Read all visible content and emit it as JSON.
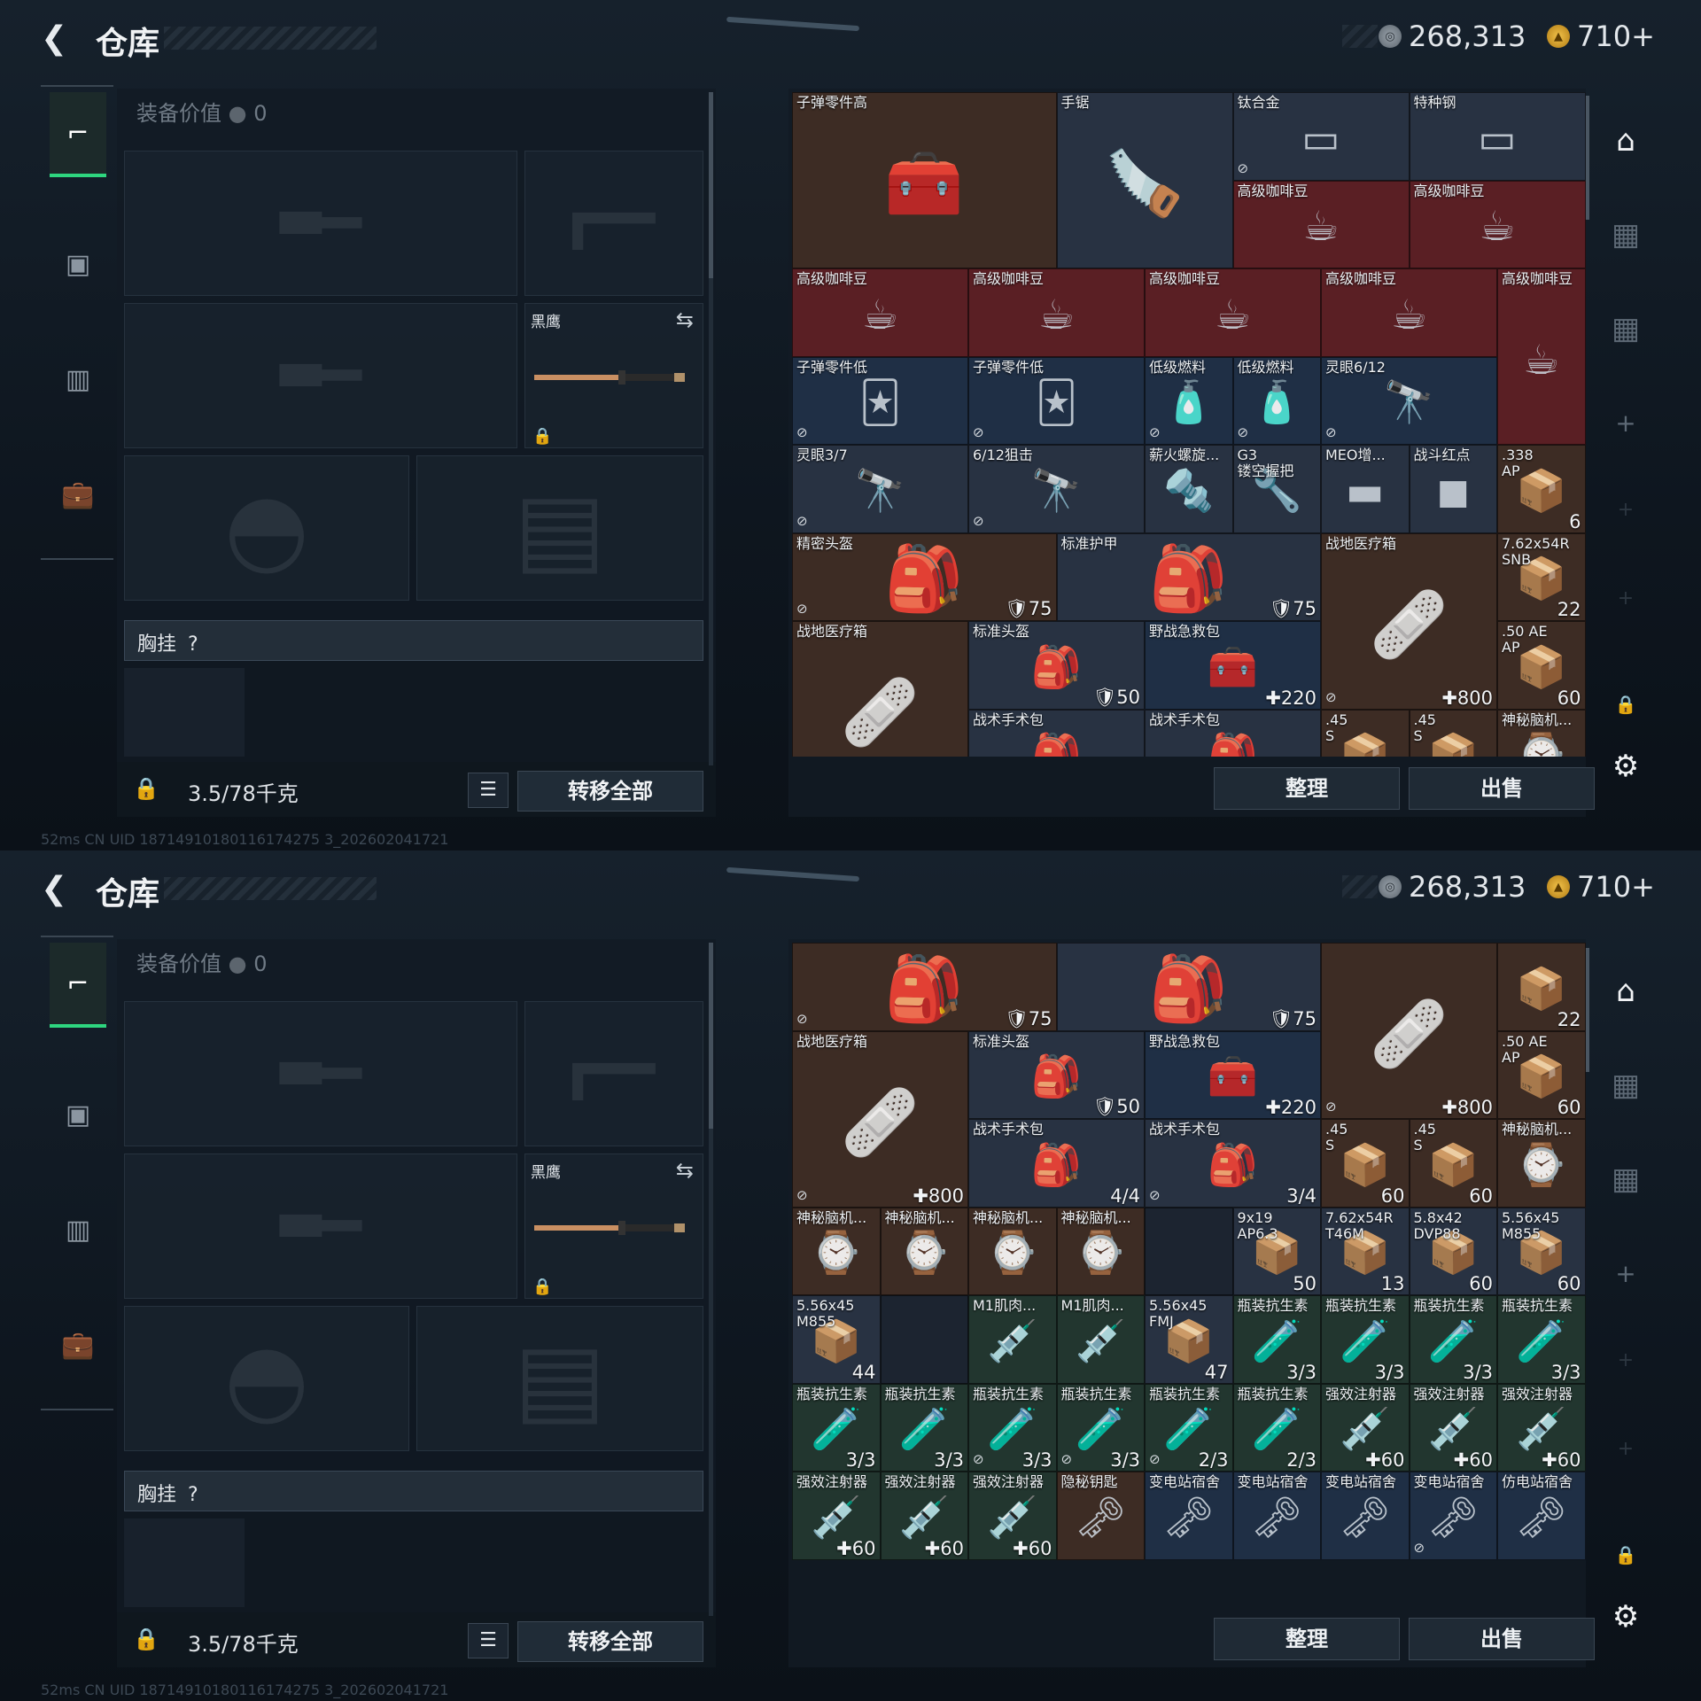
{
  "header": {
    "title": "仓库",
    "silver": "268,313",
    "gold": "710+"
  },
  "loadout": {
    "equip_value_label": "装备价值",
    "equip_value": "0",
    "melee_label": "黑鹰",
    "chest_label": "胸挂",
    "chest_help": "?",
    "weight": "3.5/78千克",
    "transfer_all": "转移全部"
  },
  "storage": {
    "sort": "整理",
    "sell": "出售"
  },
  "status_text": "52ms   CN UID 18714910180116174275 3_202602041721",
  "screen1_cells": [
    {
      "c": 0,
      "r": 0,
      "w": 3,
      "h": 2,
      "n": "子弹零件高",
      "bg": "c-brown",
      "i": "🧰"
    },
    {
      "c": 3,
      "r": 0,
      "w": 2,
      "h": 2,
      "n": "手锯",
      "bg": "c-slate",
      "i": "🪚"
    },
    {
      "c": 5,
      "r": 0,
      "w": 2,
      "h": 1,
      "n": "钛合金",
      "bg": "c-slate",
      "i": "▭",
      "nl": true
    },
    {
      "c": 7,
      "r": 0,
      "w": 2,
      "h": 1,
      "n": "特种钢",
      "bg": "c-slate",
      "i": "▭"
    },
    {
      "c": 5,
      "r": 1,
      "w": 2,
      "h": 1,
      "n": "高级咖啡豆",
      "bg": "c-red",
      "i": "☕"
    },
    {
      "c": 7,
      "r": 1,
      "w": 2,
      "h": 1,
      "n": "高级咖啡豆",
      "bg": "c-red",
      "i": "☕"
    },
    {
      "c": 0,
      "r": 2,
      "w": 2,
      "h": 1,
      "n": "高级咖啡豆",
      "bg": "c-red",
      "i": "☕"
    },
    {
      "c": 2,
      "r": 2,
      "w": 2,
      "h": 1,
      "n": "高级咖啡豆",
      "bg": "c-red",
      "i": "☕"
    },
    {
      "c": 4,
      "r": 2,
      "w": 2,
      "h": 1,
      "n": "高级咖啡豆",
      "bg": "c-red",
      "i": "☕"
    },
    {
      "c": 6,
      "r": 2,
      "w": 2,
      "h": 1,
      "n": "高级咖啡豆",
      "bg": "c-red",
      "i": "☕"
    },
    {
      "c": 8,
      "r": 2,
      "w": 1,
      "h": 2,
      "n": "高级咖啡豆",
      "bg": "c-red",
      "i": "☕"
    },
    {
      "c": 0,
      "r": 3,
      "w": 2,
      "h": 1,
      "n": "子弹零件低",
      "bg": "c-blue",
      "i": "🃏",
      "nl": true
    },
    {
      "c": 2,
      "r": 3,
      "w": 2,
      "h": 1,
      "n": "子弹零件低",
      "bg": "c-blue",
      "i": "🃏",
      "nl": true
    },
    {
      "c": 4,
      "r": 3,
      "w": 1,
      "h": 1,
      "n": "低级燃料",
      "bg": "c-blue",
      "i": "🧴",
      "nl": true
    },
    {
      "c": 5,
      "r": 3,
      "w": 1,
      "h": 1,
      "n": "低级燃料",
      "bg": "c-blue",
      "i": "🧴",
      "nl": true
    },
    {
      "c": 6,
      "r": 3,
      "w": 2,
      "h": 1,
      "n": "灵眼6/12",
      "bg": "c-blue",
      "i": "🔭",
      "nl": true
    },
    {
      "c": 0,
      "r": 4,
      "w": 2,
      "h": 1,
      "n": "灵眼3/7",
      "bg": "c-slate",
      "i": "🔭",
      "nl": true
    },
    {
      "c": 2,
      "r": 4,
      "w": 2,
      "h": 1,
      "n": "6/12狙击",
      "bg": "c-slate",
      "i": "🔭",
      "nl": true
    },
    {
      "c": 4,
      "r": 4,
      "w": 1,
      "h": 1,
      "n": "薪火螺旋...",
      "bg": "c-slate",
      "i": "🔩"
    },
    {
      "c": 5,
      "r": 4,
      "w": 1,
      "h": 1,
      "n": "G3\n镂空握把",
      "bg": "c-slate",
      "i": "🔧"
    },
    {
      "c": 6,
      "r": 4,
      "w": 1,
      "h": 1,
      "n": "MEO增...",
      "bg": "c-slate",
      "i": "▬"
    },
    {
      "c": 7,
      "r": 4,
      "w": 1,
      "h": 1,
      "n": "战斗红点",
      "bg": "c-slate",
      "i": "◼"
    },
    {
      "c": 8,
      "r": 4,
      "w": 1,
      "h": 1,
      "n": ".338\nAP",
      "bg": "c-brown",
      "i": "📦",
      "ct": "6"
    },
    {
      "c": 0,
      "r": 5,
      "w": 3,
      "h": 1,
      "n": "精密头盔",
      "bg": "c-brown",
      "i": "🎒",
      "ct": "🛡75",
      "nl": true
    },
    {
      "c": 3,
      "r": 5,
      "w": 3,
      "h": 1,
      "n": "标准护甲",
      "bg": "c-slate",
      "i": "🎒",
      "ct": "🛡75"
    },
    {
      "c": 6,
      "r": 5,
      "w": 2,
      "h": 2,
      "n": "战地医疗箱",
      "bg": "c-brown",
      "i": "🩹",
      "ct": "✚800",
      "nl": true
    },
    {
      "c": 8,
      "r": 5,
      "w": 1,
      "h": 1,
      "n": "7.62x54R\nSNB",
      "bg": "c-brown",
      "i": "📦",
      "ct": "22"
    },
    {
      "c": 0,
      "r": 6,
      "w": 2,
      "h": 2,
      "n": "战地医疗箱",
      "bg": "c-brown",
      "i": "🩹"
    },
    {
      "c": 2,
      "r": 6,
      "w": 2,
      "h": 1,
      "n": "标准头盔",
      "bg": "c-slate",
      "i": "🎒",
      "ct": "🛡50"
    },
    {
      "c": 4,
      "r": 6,
      "w": 2,
      "h": 1,
      "n": "野战急救包",
      "bg": "c-blue",
      "i": "🧰",
      "ct": "✚220"
    },
    {
      "c": 8,
      "r": 6,
      "w": 1,
      "h": 1,
      "n": ".50 AE\nAP",
      "bg": "c-brown",
      "i": "📦",
      "ct": "60"
    },
    {
      "c": 2,
      "r": 7,
      "w": 2,
      "h": 1,
      "n": "战术手术包",
      "bg": "c-slate",
      "i": "🎒"
    },
    {
      "c": 4,
      "r": 7,
      "w": 2,
      "h": 1,
      "n": "战术手术包",
      "bg": "c-slate",
      "i": "🎒"
    },
    {
      "c": 6,
      "r": 7,
      "w": 1,
      "h": 1,
      "n": ".45\nS",
      "bg": "c-brown",
      "i": "📦"
    },
    {
      "c": 7,
      "r": 7,
      "w": 1,
      "h": 1,
      "n": ".45\nS",
      "bg": "c-brown",
      "i": "📦"
    },
    {
      "c": 8,
      "r": 7,
      "w": 1,
      "h": 1,
      "n": "神秘脑机...",
      "bg": "c-brown",
      "i": "⌚"
    }
  ],
  "screen2_cells": [
    {
      "c": 0,
      "r": 0,
      "w": 3,
      "h": 1,
      "n": "",
      "bg": "c-brown",
      "i": "🎒",
      "ct": "🛡75",
      "nl": true
    },
    {
      "c": 3,
      "r": 0,
      "w": 3,
      "h": 1,
      "n": "",
      "bg": "c-slate",
      "i": "🎒",
      "ct": "🛡75"
    },
    {
      "c": 6,
      "r": 0,
      "w": 2,
      "h": 2,
      "n": "",
      "bg": "c-brown",
      "i": "🩹",
      "ct": "✚800",
      "nl": true
    },
    {
      "c": 8,
      "r": 0,
      "w": 1,
      "h": 1,
      "n": "",
      "bg": "c-brown",
      "i": "📦",
      "ct": "22"
    },
    {
      "c": 0,
      "r": 1,
      "w": 2,
      "h": 2,
      "n": "战地医疗箱",
      "bg": "c-brown",
      "i": "🩹",
      "ct": "✚800",
      "nl": true
    },
    {
      "c": 2,
      "r": 1,
      "w": 2,
      "h": 1,
      "n": "标准头盔",
      "bg": "c-slate",
      "i": "🎒",
      "ct": "🛡50"
    },
    {
      "c": 4,
      "r": 1,
      "w": 2,
      "h": 1,
      "n": "野战急救包",
      "bg": "c-blue",
      "i": "🧰",
      "ct": "✚220"
    },
    {
      "c": 8,
      "r": 1,
      "w": 1,
      "h": 1,
      "n": ".50 AE\nAP",
      "bg": "c-brown",
      "i": "📦",
      "ct": "60"
    },
    {
      "c": 2,
      "r": 2,
      "w": 2,
      "h": 1,
      "n": "战术手术包",
      "bg": "c-slate",
      "i": "🎒",
      "ct": "4/4"
    },
    {
      "c": 4,
      "r": 2,
      "w": 2,
      "h": 1,
      "n": "战术手术包",
      "bg": "c-slate",
      "i": "🎒",
      "ct": "3/4",
      "nl": true
    },
    {
      "c": 6,
      "r": 2,
      "w": 1,
      "h": 1,
      "n": ".45\nS",
      "bg": "c-brown",
      "i": "📦",
      "ct": "60"
    },
    {
      "c": 7,
      "r": 2,
      "w": 1,
      "h": 1,
      "n": ".45\nS",
      "bg": "c-brown",
      "i": "📦",
      "ct": "60"
    },
    {
      "c": 8,
      "r": 2,
      "w": 1,
      "h": 1,
      "n": "神秘脑机...",
      "bg": "c-brown",
      "i": "⌚"
    },
    {
      "c": 0,
      "r": 3,
      "w": 1,
      "h": 1,
      "n": "神秘脑机...",
      "bg": "c-brown",
      "i": "⌚"
    },
    {
      "c": 1,
      "r": 3,
      "w": 1,
      "h": 1,
      "n": "神秘脑机...",
      "bg": "c-brown",
      "i": "⌚"
    },
    {
      "c": 2,
      "r": 3,
      "w": 1,
      "h": 1,
      "n": "神秘脑机...",
      "bg": "c-brown",
      "i": "⌚"
    },
    {
      "c": 3,
      "r": 3,
      "w": 1,
      "h": 1,
      "n": "神秘脑机...",
      "bg": "c-brown",
      "i": "⌚"
    },
    {
      "c": 4,
      "r": 3,
      "w": 1,
      "h": 1,
      "n": "",
      "bg": "c-dark",
      "i": ""
    },
    {
      "c": 5,
      "r": 3,
      "w": 1,
      "h": 1,
      "n": "9x19\nAP6.3",
      "bg": "c-slate",
      "i": "📦",
      "ct": "50"
    },
    {
      "c": 6,
      "r": 3,
      "w": 1,
      "h": 1,
      "n": "7.62x54R\nT46M",
      "bg": "c-slate",
      "i": "📦",
      "ct": "13"
    },
    {
      "c": 7,
      "r": 3,
      "w": 1,
      "h": 1,
      "n": "5.8x42\nDVP88",
      "bg": "c-slate",
      "i": "📦",
      "ct": "60"
    },
    {
      "c": 8,
      "r": 3,
      "w": 1,
      "h": 1,
      "n": "5.56x45\nM855",
      "bg": "c-slate",
      "i": "📦",
      "ct": "60"
    },
    {
      "c": 0,
      "r": 4,
      "w": 1,
      "h": 1,
      "n": "5.56x45\nM855",
      "bg": "c-slate",
      "i": "📦",
      "ct": "44"
    },
    {
      "c": 1,
      "r": 4,
      "w": 1,
      "h": 1,
      "n": "",
      "bg": "c-dark",
      "i": ""
    },
    {
      "c": 2,
      "r": 4,
      "w": 1,
      "h": 1,
      "n": "M1肌肉...",
      "bg": "c-green",
      "i": "💉"
    },
    {
      "c": 3,
      "r": 4,
      "w": 1,
      "h": 1,
      "n": "M1肌肉...",
      "bg": "c-green",
      "i": "💉"
    },
    {
      "c": 4,
      "r": 4,
      "w": 1,
      "h": 1,
      "n": "5.56x45\nFMJ",
      "bg": "c-slate",
      "i": "📦",
      "ct": "47"
    },
    {
      "c": 5,
      "r": 4,
      "w": 1,
      "h": 1,
      "n": "瓶装抗生素",
      "bg": "c-green",
      "i": "🧪",
      "ct": "3/3"
    },
    {
      "c": 6,
      "r": 4,
      "w": 1,
      "h": 1,
      "n": "瓶装抗生素",
      "bg": "c-green",
      "i": "🧪",
      "ct": "3/3"
    },
    {
      "c": 7,
      "r": 4,
      "w": 1,
      "h": 1,
      "n": "瓶装抗生素",
      "bg": "c-green",
      "i": "🧪",
      "ct": "3/3"
    },
    {
      "c": 8,
      "r": 4,
      "w": 1,
      "h": 1,
      "n": "瓶装抗生素",
      "bg": "c-green",
      "i": "🧪",
      "ct": "3/3"
    },
    {
      "c": 0,
      "r": 5,
      "w": 1,
      "h": 1,
      "n": "瓶装抗生素",
      "bg": "c-green",
      "i": "🧪",
      "ct": "3/3"
    },
    {
      "c": 1,
      "r": 5,
      "w": 1,
      "h": 1,
      "n": "瓶装抗生素",
      "bg": "c-green",
      "i": "🧪",
      "ct": "3/3"
    },
    {
      "c": 2,
      "r": 5,
      "w": 1,
      "h": 1,
      "n": "瓶装抗生素",
      "bg": "c-green",
      "i": "🧪",
      "ct": "3/3",
      "nl": true
    },
    {
      "c": 3,
      "r": 5,
      "w": 1,
      "h": 1,
      "n": "瓶装抗生素",
      "bg": "c-green",
      "i": "🧪",
      "ct": "3/3",
      "nl": true
    },
    {
      "c": 4,
      "r": 5,
      "w": 1,
      "h": 1,
      "n": "瓶装抗生素",
      "bg": "c-green",
      "i": "🧪",
      "ct": "2/3",
      "nl": true
    },
    {
      "c": 5,
      "r": 5,
      "w": 1,
      "h": 1,
      "n": "瓶装抗生素",
      "bg": "c-green",
      "i": "🧪",
      "ct": "2/3"
    },
    {
      "c": 6,
      "r": 5,
      "w": 1,
      "h": 1,
      "n": "强效注射器",
      "bg": "c-green",
      "i": "💉",
      "ct": "✚60"
    },
    {
      "c": 7,
      "r": 5,
      "w": 1,
      "h": 1,
      "n": "强效注射器",
      "bg": "c-green",
      "i": "💉",
      "ct": "✚60"
    },
    {
      "c": 8,
      "r": 5,
      "w": 1,
      "h": 1,
      "n": "强效注射器",
      "bg": "c-green",
      "i": "💉",
      "ct": "✚60"
    },
    {
      "c": 0,
      "r": 6,
      "w": 1,
      "h": 1,
      "n": "强效注射器",
      "bg": "c-green",
      "i": "💉",
      "ct": "✚60"
    },
    {
      "c": 1,
      "r": 6,
      "w": 1,
      "h": 1,
      "n": "强效注射器",
      "bg": "c-green",
      "i": "💉",
      "ct": "✚60"
    },
    {
      "c": 2,
      "r": 6,
      "w": 1,
      "h": 1,
      "n": "强效注射器",
      "bg": "c-green",
      "i": "💉",
      "ct": "✚60"
    },
    {
      "c": 3,
      "r": 6,
      "w": 1,
      "h": 1,
      "n": "隐秘钥匙",
      "bg": "c-brown",
      "i": "🗝"
    },
    {
      "c": 4,
      "r": 6,
      "w": 1,
      "h": 1,
      "n": "变电站宿舍",
      "bg": "c-blue",
      "i": "🗝"
    },
    {
      "c": 5,
      "r": 6,
      "w": 1,
      "h": 1,
      "n": "变电站宿舍",
      "bg": "c-blue",
      "i": "🗝"
    },
    {
      "c": 6,
      "r": 6,
      "w": 1,
      "h": 1,
      "n": "变电站宿舍",
      "bg": "c-blue",
      "i": "🗝"
    },
    {
      "c": 7,
      "r": 6,
      "w": 1,
      "h": 1,
      "n": "变电站宿舍",
      "bg": "c-blue",
      "i": "🗝",
      "nl": true
    },
    {
      "c": 8,
      "r": 6,
      "w": 1,
      "h": 1,
      "n": "仿电站宿舍",
      "bg": "c-blue",
      "i": "🗝"
    }
  ]
}
